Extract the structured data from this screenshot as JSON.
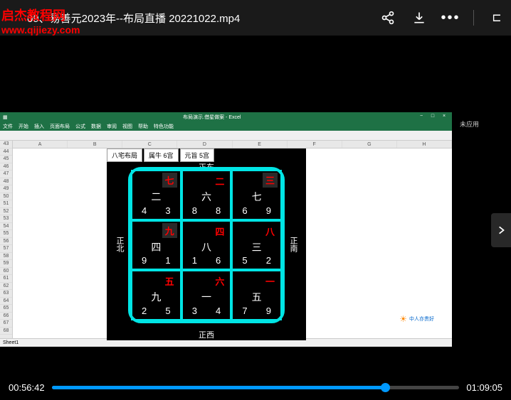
{
  "watermark": {
    "title": "启杰教程网",
    "url": "www.qijiezy.com"
  },
  "header": {
    "video_title": "09、易善元2023年--布局直播 20221022.mp4"
  },
  "player": {
    "current_time": "00:56:42",
    "total_time": "01:09:05",
    "progress_percent": 82
  },
  "sidebar": {
    "label": "未应用"
  },
  "excel": {
    "title": "布局演示.借星做案 - Excel",
    "ribbon_tabs": [
      "文件",
      "开始",
      "插入",
      "页面布局",
      "公式",
      "数据",
      "审阅",
      "视图",
      "帮助",
      "特色功能"
    ],
    "columns": [
      "A",
      "B",
      "C",
      "D",
      "E",
      "F",
      "G",
      "H"
    ],
    "rows": [
      "43",
      "44",
      "45",
      "46",
      "47",
      "48",
      "49",
      "50",
      "51",
      "52",
      "53",
      "54",
      "55",
      "56",
      "57",
      "58",
      "59",
      "60",
      "61",
      "62",
      "63",
      "64",
      "65",
      "66",
      "67",
      "68"
    ],
    "sheet": "Sheet1"
  },
  "chart": {
    "tabs": {
      "tab1": "八宅布局",
      "tab2": "属牛 6宫",
      "tab3": "元旨 5宫"
    },
    "directions": {
      "north": "正东",
      "south": "正西",
      "west": "正北",
      "east": "正南"
    },
    "cells": [
      {
        "red": "七",
        "center": "二",
        "bl": "4",
        "br": "3",
        "boxed": true
      },
      {
        "red": "二",
        "center": "六",
        "bl": "8",
        "br": "8",
        "boxed": false
      },
      {
        "red": "三",
        "center": "七",
        "bl": "6",
        "br": "9",
        "boxed": true
      },
      {
        "red": "九",
        "center": "四",
        "bl": "9",
        "br": "1",
        "boxed": true
      },
      {
        "red": "四",
        "center": "八",
        "bl": "1",
        "br": "6",
        "boxed": false
      },
      {
        "red": "八",
        "center": "三",
        "bl": "5",
        "br": "2",
        "boxed": false
      },
      {
        "red": "五",
        "center": "九",
        "bl": "2",
        "br": "5",
        "boxed": false
      },
      {
        "red": "六",
        "center": "一",
        "bl": "3",
        "br": "4",
        "boxed": false
      },
      {
        "red": "一",
        "center": "五",
        "bl": "7",
        "br": "9",
        "boxed": false
      }
    ]
  },
  "bottom_text": "中人亦贵好"
}
